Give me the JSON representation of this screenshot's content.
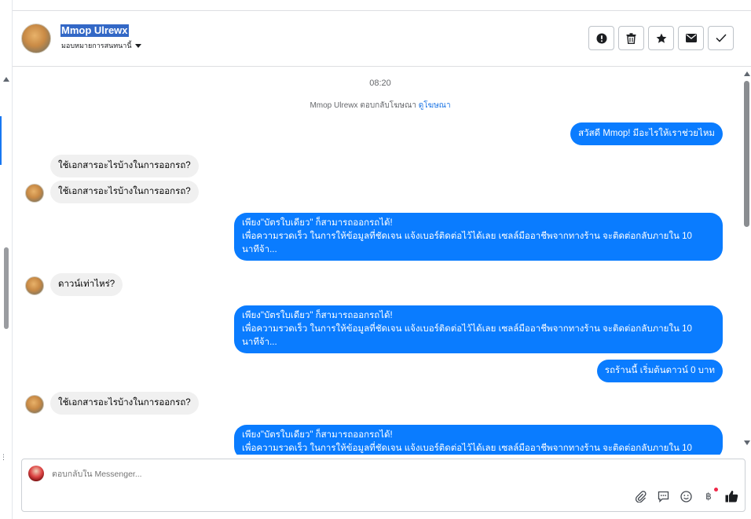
{
  "header": {
    "contact_name": "Mmop Ulrewx",
    "assign_label": "มอบหมายการสนทนานี้",
    "actions": [
      {
        "name": "report-spam-button",
        "icon": "exclamation-circle-icon"
      },
      {
        "name": "delete-button",
        "icon": "trash-icon"
      },
      {
        "name": "star-button",
        "icon": "star-icon"
      },
      {
        "name": "mark-unread-button",
        "icon": "envelope-icon"
      },
      {
        "name": "mark-done-button",
        "icon": "check-icon"
      }
    ]
  },
  "chat": {
    "timestamp": "08:20",
    "notice_text": "Mmop Ulrewx ตอบกลับโฆษณา",
    "notice_link": "ดูโฆษณา",
    "messages": [
      {
        "dir": "out",
        "lines": [
          "สวัสดี Mmop! มีอะไรให้เราช่วยไหม"
        ]
      },
      {
        "dir": "in",
        "lines": [
          "ใช้เอกสารอะไรบ้างในการออกรถ?"
        ]
      },
      {
        "dir": "in",
        "lines": [
          "ใช้เอกสารอะไรบ้างในการออกรถ?"
        ]
      },
      {
        "dir": "out",
        "lines": [
          "เพียง\"บัตรใบเดียว\" ก็สามารถออกรถได้!",
          "เพื่อความรวดเร็ว ในการให้ข้อมูลที่ชัดเจน แจ้งเบอร์ติดต่อไว้ได้เลย เซลล์มืออาชีพจากทางร้าน จะติดต่อกลับภายใน 10",
          "นาทีจ้า..."
        ]
      },
      {
        "dir": "in",
        "lines": [
          "ดาวน์เท่าไหร่?"
        ]
      },
      {
        "dir": "out",
        "lines": [
          "เพียง\"บัตรใบเดียว\" ก็สามารถออกรถได้!",
          "เพื่อความรวดเร็ว ในการให้ข้อมูลที่ชัดเจน แจ้งเบอร์ติดต่อไว้ได้เลย เซลล์มืออาชีพจากทางร้าน จะติดต่อกลับภายใน 10",
          "นาทีจ้า..."
        ]
      },
      {
        "dir": "out",
        "lines": [
          "รถร้านนี้ เริ่มต้นดาวน์ 0 บาท"
        ]
      },
      {
        "dir": "in",
        "lines": [
          "ใช้เอกสารอะไรบ้างในการออกรถ?"
        ]
      },
      {
        "dir": "out",
        "lines": [
          "เพียง\"บัตรใบเดียว\" ก็สามารถออกรถได้!",
          "เพื่อความรวดเร็ว ในการให้ข้อมูลที่ชัดเจน แจ้งเบอร์ติดต่อไว้ได้เลย เซลล์มืออาชีพจากทางร้าน จะติดต่อกลับภายใน 10"
        ]
      }
    ]
  },
  "composer": {
    "placeholder": "ตอบกลับใน Messenger...",
    "icons": [
      "attachment-icon",
      "saved-reply-icon",
      "emoji-icon",
      "payment-icon",
      "like-icon"
    ]
  },
  "colors": {
    "outgoing_bubble": "#0a7cff",
    "incoming_bubble": "#f0f0f0",
    "link": "#1b74e4",
    "highlight": "#3368c6"
  }
}
